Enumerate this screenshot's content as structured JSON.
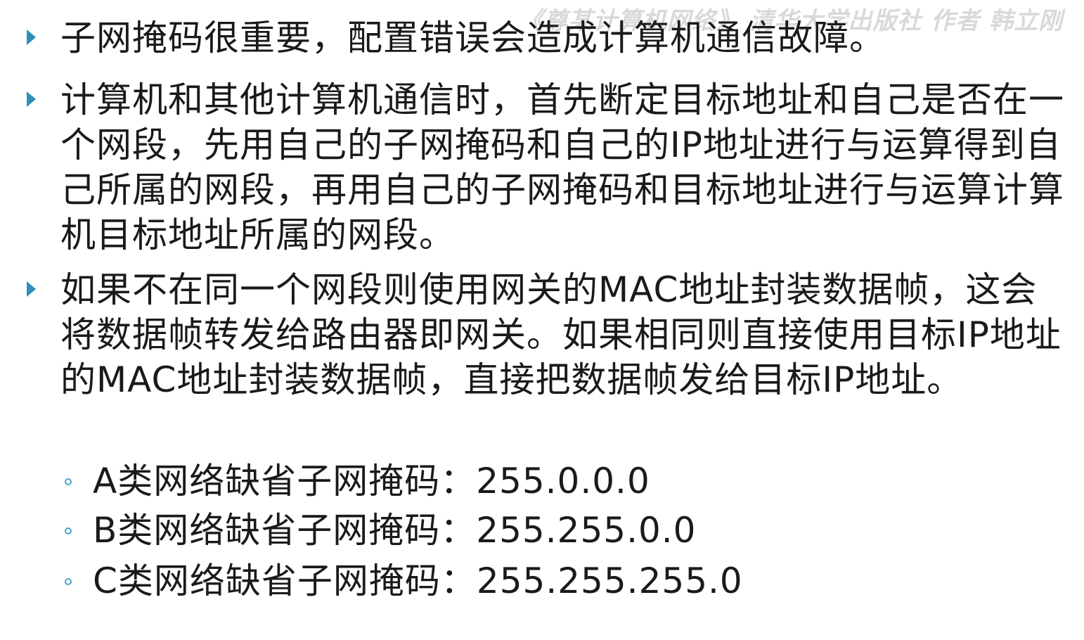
{
  "watermark": "《尊某计算机网络》 清华大学出版社 作者 韩立刚",
  "bullets": [
    {
      "icon": "triangle-bullet-icon",
      "text": "子网掩码很重要，配置错误会造成计算机通信故障。"
    },
    {
      "icon": "triangle-bullet-icon",
      "text": "计算机和其他计算机通信时，首先断定目标地址和自己是否在一个网段，先用自己的子网掩码和自己的IP地址进行与运算得到自己所属的网段，再用自己的子网掩码和目标地址进行与运算计算机目标地址所属的网段。"
    },
    {
      "icon": "triangle-bullet-icon",
      "text": "如果不在同一个网段则使用网关的MAC地址封装数据帧，这会将数据帧转发给路由器即网关。如果相同则直接使用目标IP地址的MAC地址封装数据帧，直接把数据帧发给目标IP地址。"
    }
  ],
  "subitems": [
    {
      "icon": "circle-bullet-icon",
      "text": "A类网络缺省子网掩码：255.0.0.0"
    },
    {
      "icon": "circle-bullet-icon",
      "text": "B类网络缺省子网掩码：255.255.0.0"
    },
    {
      "icon": "circle-bullet-icon",
      "text": "C类网络缺省子网掩码：255.255.255.0"
    }
  ],
  "colors": {
    "bullet_triangle": "#2e8fb8",
    "bullet_circle": "#4aa3c8",
    "text": "#1a1a1a",
    "watermark": "#d9d9d9"
  }
}
